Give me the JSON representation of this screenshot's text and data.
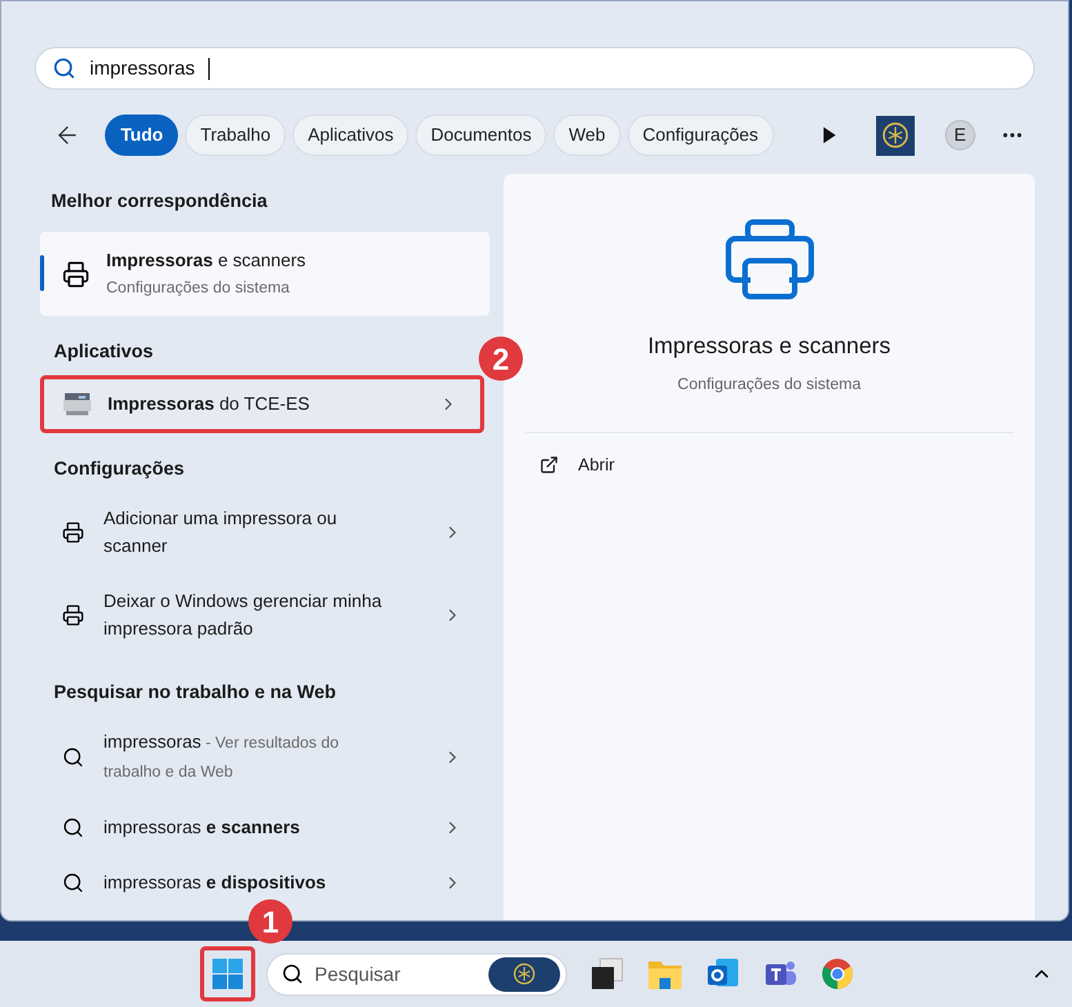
{
  "search": {
    "value": "impressoras"
  },
  "filters": [
    {
      "label": "Tudo",
      "selected": true
    },
    {
      "label": "Trabalho",
      "selected": false
    },
    {
      "label": "Aplicativos",
      "selected": false
    },
    {
      "label": "Documentos",
      "selected": false
    },
    {
      "label": "Web",
      "selected": false
    },
    {
      "label": "Configurações",
      "selected": false
    }
  ],
  "account": {
    "initial": "E"
  },
  "best_match": {
    "heading": "Melhor correspondência",
    "title": "**Impressoras** e scanners",
    "subtitle": "Configurações do sistema",
    "selected": true
  },
  "sections": [
    {
      "heading": "Aplicativos",
      "items": [
        {
          "kind": "app",
          "title": "**Impressoras** do TCE-ES",
          "highlighted": true
        }
      ]
    },
    {
      "heading": "Configurações",
      "items": [
        {
          "kind": "setting",
          "title": "Adicionar uma impressora ou scanner",
          "highlighted": false
        },
        {
          "kind": "setting",
          "title": "Deixar o Windows gerenciar minha impressora padrão",
          "highlighted": false
        }
      ]
    },
    {
      "heading": "Pesquisar no trabalho e na Web",
      "items": [
        {
          "kind": "web",
          "title": "impressoras",
          "subtitle": "- Ver resultados do trabalho e da Web",
          "highlighted": false
        },
        {
          "kind": "web",
          "title": "impressoras **e scanners**",
          "highlighted": false
        },
        {
          "kind": "web",
          "title": "impressoras **e dispositivos**",
          "highlighted": false
        }
      ]
    }
  ],
  "detail": {
    "title": "Impressoras e scanners",
    "subtitle": "Configurações do sistema",
    "actions": [
      {
        "label": "Abrir"
      }
    ]
  },
  "taskbar": {
    "start_highlighted": true,
    "search_placeholder": "Pesquisar"
  },
  "annotations": [
    {
      "label": "1"
    },
    {
      "label": "2"
    }
  ]
}
